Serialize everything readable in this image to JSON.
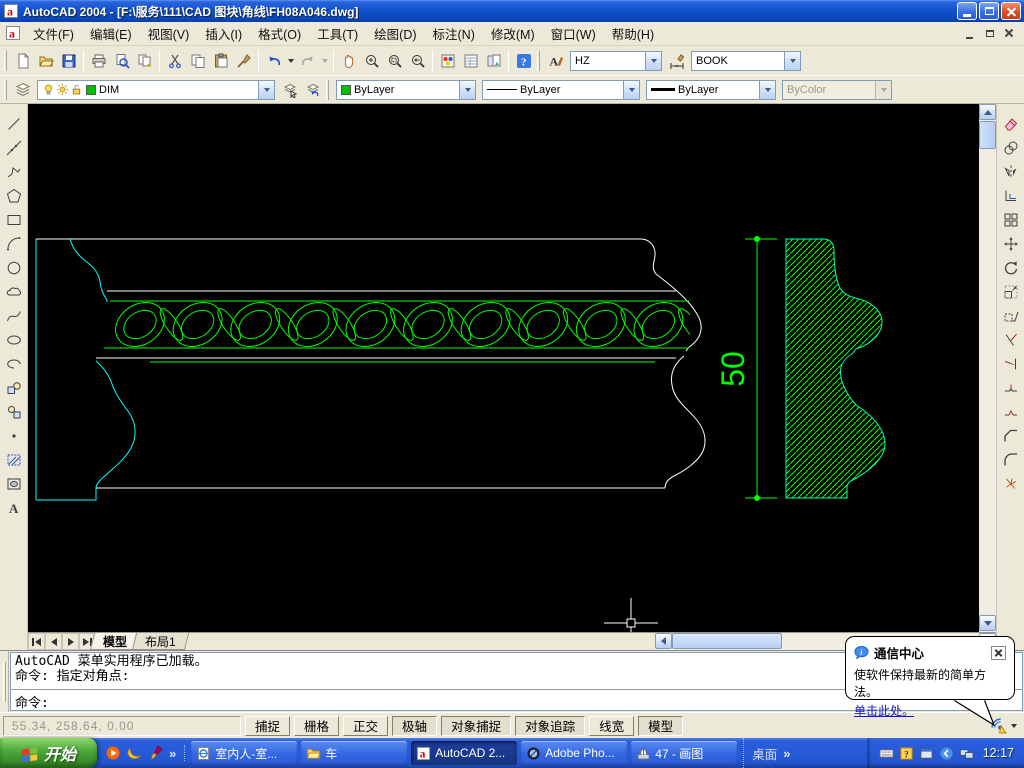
{
  "window": {
    "title": "AutoCAD 2004 - [F:\\服务\\111\\CAD 图块\\角线\\FH08A046.dwg]"
  },
  "menu": {
    "items": [
      "文件(F)",
      "编辑(E)",
      "视图(V)",
      "插入(I)",
      "格式(O)",
      "工具(T)",
      "绘图(D)",
      "标注(N)",
      "修改(M)",
      "窗口(W)",
      "帮助(H)"
    ]
  },
  "standard_toolbar": {
    "icons": [
      "new",
      "open",
      "save",
      "|",
      "plot",
      "plot-preview",
      "publish",
      "|",
      "cut",
      "copy",
      "paste",
      "match-properties",
      "|",
      "undo",
      "dd",
      "redo",
      "ddg",
      "|",
      "pan",
      "zoom-realtime",
      "zoom-window",
      "zoom-previous",
      "|",
      "tool-palettes",
      "properties",
      "designcenter",
      "|",
      "help"
    ]
  },
  "styles_toolbar": {
    "text_style": "HZ",
    "dim_style": "BOOK"
  },
  "layers_toolbar": {
    "layer": "DIM"
  },
  "properties_toolbar": {
    "color": "ByLayer",
    "linetype": "ByLayer",
    "lineweight": "ByLayer",
    "plot_style": "ByColor"
  },
  "draw_toolbar": {
    "icons": [
      "line",
      "construction-line",
      "polyline",
      "polygon",
      "rectangle",
      "arc",
      "circle",
      "revcloud",
      "spline",
      "ellipse",
      "ellipse-arc",
      "insert-block",
      "make-block",
      "point",
      "hatch",
      "region",
      "mtext"
    ]
  },
  "modify_toolbar": {
    "icons": [
      "erase",
      "copy-object",
      "mirror",
      "offset",
      "array",
      "move",
      "rotate",
      "scale",
      "stretch",
      "trim",
      "extend",
      "break-at-point",
      "break",
      "chamfer",
      "fillet",
      "explode"
    ]
  },
  "tabs": {
    "model": "模型",
    "layout": "布局1"
  },
  "drawing": {
    "dimension_label": "50",
    "colors": {
      "white": "#FFFFFF",
      "cyan": "#00FFFF",
      "green": "#00FF00",
      "section_outline": "#00FFB0"
    },
    "rope_repeats": 10
  },
  "command": {
    "history1": "AutoCAD 菜单实用程序已加载。",
    "history2": "命令: 指定对角点:",
    "prompt": "命令:"
  },
  "status": {
    "coords": "55.34,  258.64, 0.00",
    "buttons": [
      {
        "label": "捕捉",
        "pressed": false
      },
      {
        "label": "栅格",
        "pressed": false
      },
      {
        "label": "正交",
        "pressed": false
      },
      {
        "label": "极轴",
        "pressed": true
      },
      {
        "label": "对象捕捉",
        "pressed": true
      },
      {
        "label": "对象追踪",
        "pressed": true
      },
      {
        "label": "线宽",
        "pressed": false
      },
      {
        "label": "模型",
        "pressed": true
      }
    ]
  },
  "balloon": {
    "title": "通信中心",
    "body": "使软件保持最新的简单方法。",
    "link": "单击此处。"
  },
  "taskbar": {
    "start": "开始",
    "overflow_chevron": "»",
    "quick_launch": [
      "media-player",
      "swoosh",
      "brush"
    ],
    "tasks": [
      {
        "label": "室内人-室...",
        "icon": "ie-page",
        "active": false
      },
      {
        "label": "车",
        "icon": "folder",
        "active": false
      },
      {
        "label": "AutoCAD 2...",
        "icon": "autocad",
        "active": true
      },
      {
        "label": "Adobe Pho...",
        "icon": "photoshop",
        "active": false
      },
      {
        "label": "47 - 画图",
        "icon": "paint",
        "active": false
      }
    ],
    "desktop": "桌面",
    "tray_icons": [
      "keyboard",
      "question",
      "window-tray",
      "collapse",
      "network"
    ],
    "clock": "12:17"
  }
}
